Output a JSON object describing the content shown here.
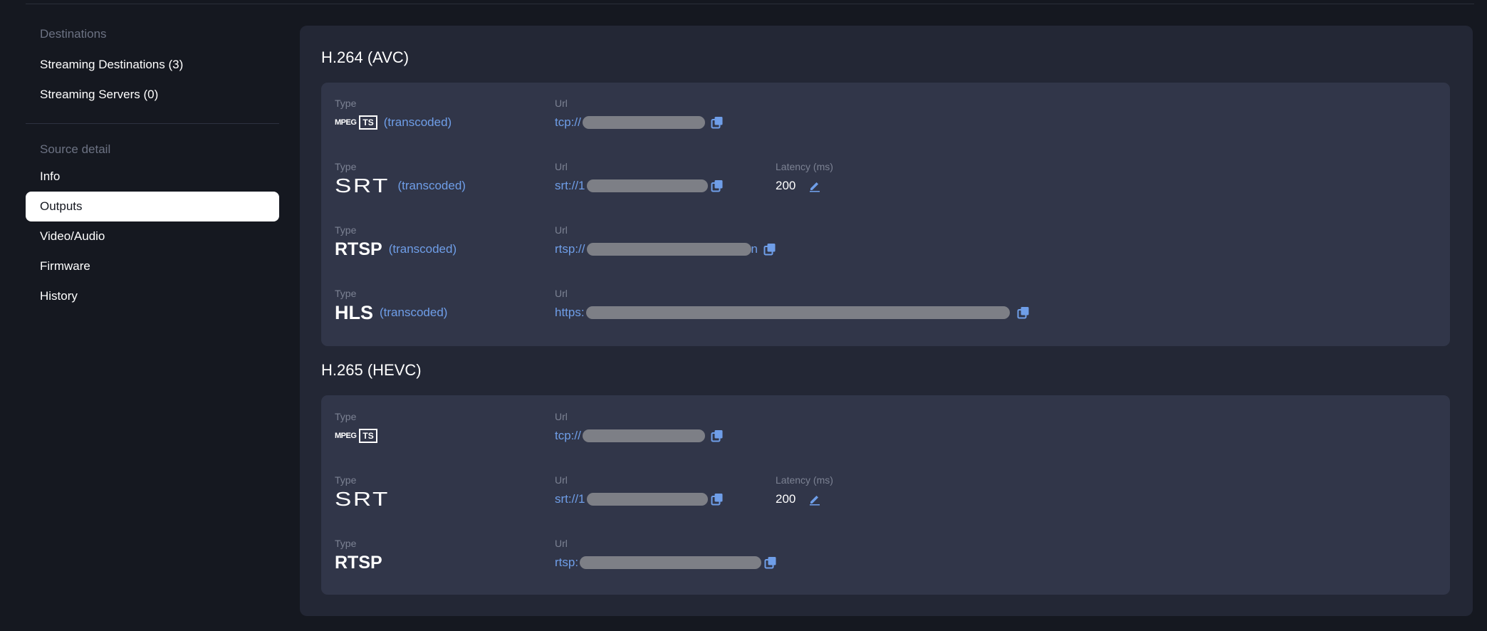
{
  "sidebar": {
    "destinations_label": "Destinations",
    "streaming_destinations": "Streaming Destinations (3)",
    "streaming_servers": "Streaming Servers (0)",
    "source_detail_label": "Source detail",
    "items": [
      "Info",
      "Outputs",
      "Video/Audio",
      "Firmware",
      "History"
    ],
    "active": "Outputs"
  },
  "labels": {
    "type": "Type",
    "url": "Url",
    "latency": "Latency (ms)",
    "transcoded": "(transcoded)"
  },
  "logos": {
    "mpeg_small": "MPEG",
    "ts": "TS",
    "srt": "SRT",
    "rtsp": "RTSP",
    "hls": "HLS"
  },
  "groups": {
    "avc": {
      "title": "H.264 (AVC)",
      "outputs": {
        "mpegts": {
          "url_prefix": "tcp://",
          "url_suffix": ""
        },
        "srt": {
          "url_prefix": "srt://1",
          "url_suffix": "",
          "latency": "200"
        },
        "rtsp": {
          "url_prefix": "rtsp://",
          "url_suffix": "n"
        },
        "hls": {
          "url_prefix": "https:",
          "url_suffix": ""
        }
      }
    },
    "hevc": {
      "title": "H.265 (HEVC)",
      "outputs": {
        "mpegts": {
          "url_prefix": "tcp://",
          "url_suffix": ""
        },
        "srt": {
          "url_prefix": "srt://1",
          "url_suffix": "",
          "latency": "200"
        },
        "rtsp": {
          "url_prefix": "rtsp:",
          "url_suffix": ""
        }
      }
    }
  },
  "colors": {
    "accent": "#6f9ee8",
    "panel": "#232735",
    "card": "#313649",
    "background": "#151820"
  },
  "icons": {
    "copy": "copy-icon",
    "edit": "pencil-icon"
  }
}
